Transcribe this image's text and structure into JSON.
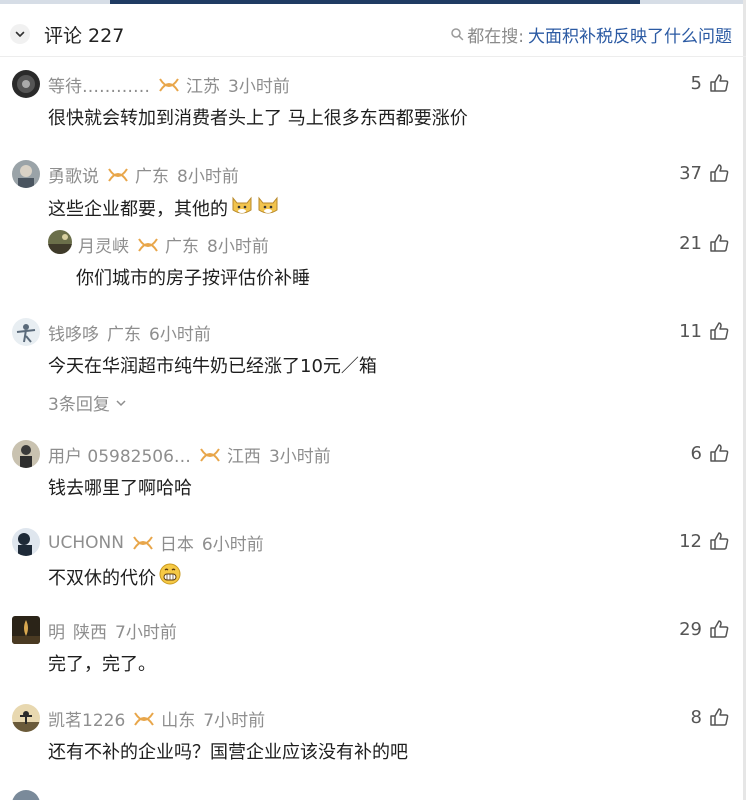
{
  "header": {
    "title": "评论 227",
    "search_prefix": "都在搜:",
    "search_text": "大面积补税反映了什么问题"
  },
  "comments": [
    {
      "user": "等待…………",
      "location": "江苏",
      "time": "3小时前",
      "text": "很快就会转加到消费者头上了 马上很多东西都要涨价",
      "likes": "5",
      "badge": true
    },
    {
      "user": "勇歌说",
      "location": "广东",
      "time": "8小时前",
      "text": "这些企业都要，其他的",
      "likes": "37",
      "badge": true
    },
    {
      "user": "月灵峡",
      "location": "广东",
      "time": "8小时前",
      "text": "你们城市的房子按评估价补睡",
      "likes": "21",
      "badge": true
    },
    {
      "user": "钱哆哆",
      "location": "广东",
      "time": "6小时前",
      "text": "今天在华润超市纯牛奶已经涨了10元／箱",
      "likes": "11",
      "badge": false,
      "more": "3条回复"
    },
    {
      "user": "用户 05982506…",
      "location": "江西",
      "time": "3小时前",
      "text": "钱去哪里了啊哈哈",
      "likes": "6",
      "badge": true
    },
    {
      "user": "UCHONN",
      "location": "日本",
      "time": "6小时前",
      "text": "不双休的代价",
      "likes": "12",
      "badge": true
    },
    {
      "user": "明",
      "location": "陕西",
      "time": "7小时前",
      "text": "完了，完了。",
      "likes": "29",
      "badge": false
    },
    {
      "user": "凯茗1226",
      "location": "山东",
      "time": "7小时前",
      "text": "还有不补的企业吗？国营企业应该没有补的吧",
      "likes": "8",
      "badge": true
    }
  ],
  "colors": {
    "accent": "#2b5aa3",
    "meta": "#8e8e8e",
    "badge": "#e8a64a"
  },
  "icons": [
    "chevron-down-icon",
    "search-icon",
    "thumbs-up-icon",
    "vip-badge-icon",
    "doge-emoji",
    "grin-emoji"
  ]
}
